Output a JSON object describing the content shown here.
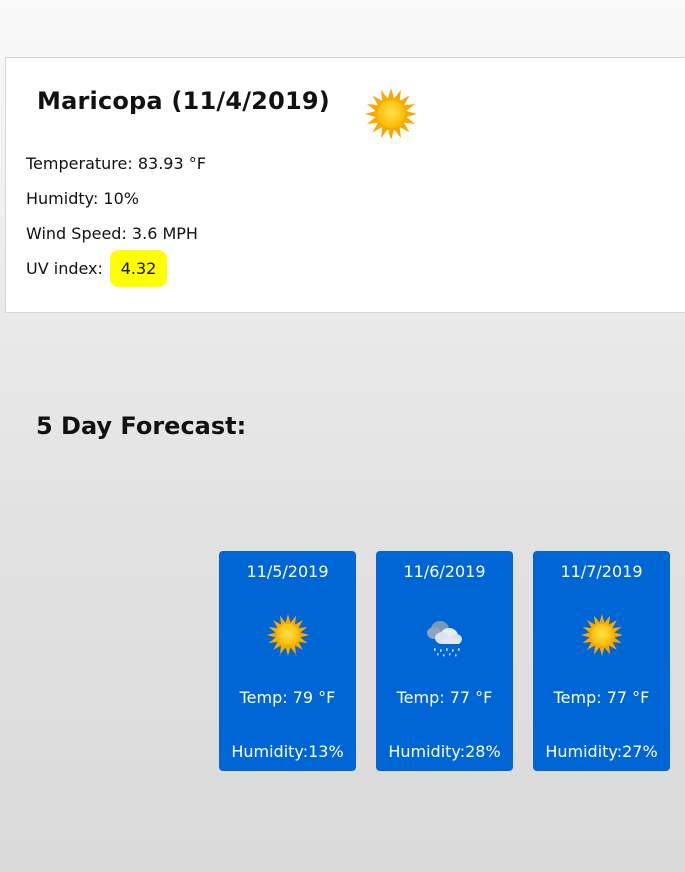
{
  "current": {
    "title": "Maricopa (11/4/2019)",
    "icon": "sun-icon",
    "temperature": "Temperature: 83.93 °F",
    "humidity": "Humidty: 10%",
    "wind": "Wind Speed: 3.6 MPH",
    "uv_label": "UV index:",
    "uv_value": "4.32",
    "uv_color": "#ffff00"
  },
  "forecast": {
    "heading": "5 Day Forecast:",
    "card_color": "#0066d6",
    "days": [
      {
        "date": "11/5/2019",
        "icon": "sun-icon",
        "temp": "Temp: 79 °F",
        "humidity": "Humidity:13%"
      },
      {
        "date": "11/6/2019",
        "icon": "rain-cloud-icon",
        "temp": "Temp: 77 °F",
        "humidity": "Humidity:28%"
      },
      {
        "date": "11/7/2019",
        "icon": "sun-icon",
        "temp": "Temp: 77 °F",
        "humidity": "Humidity:27%"
      }
    ]
  }
}
